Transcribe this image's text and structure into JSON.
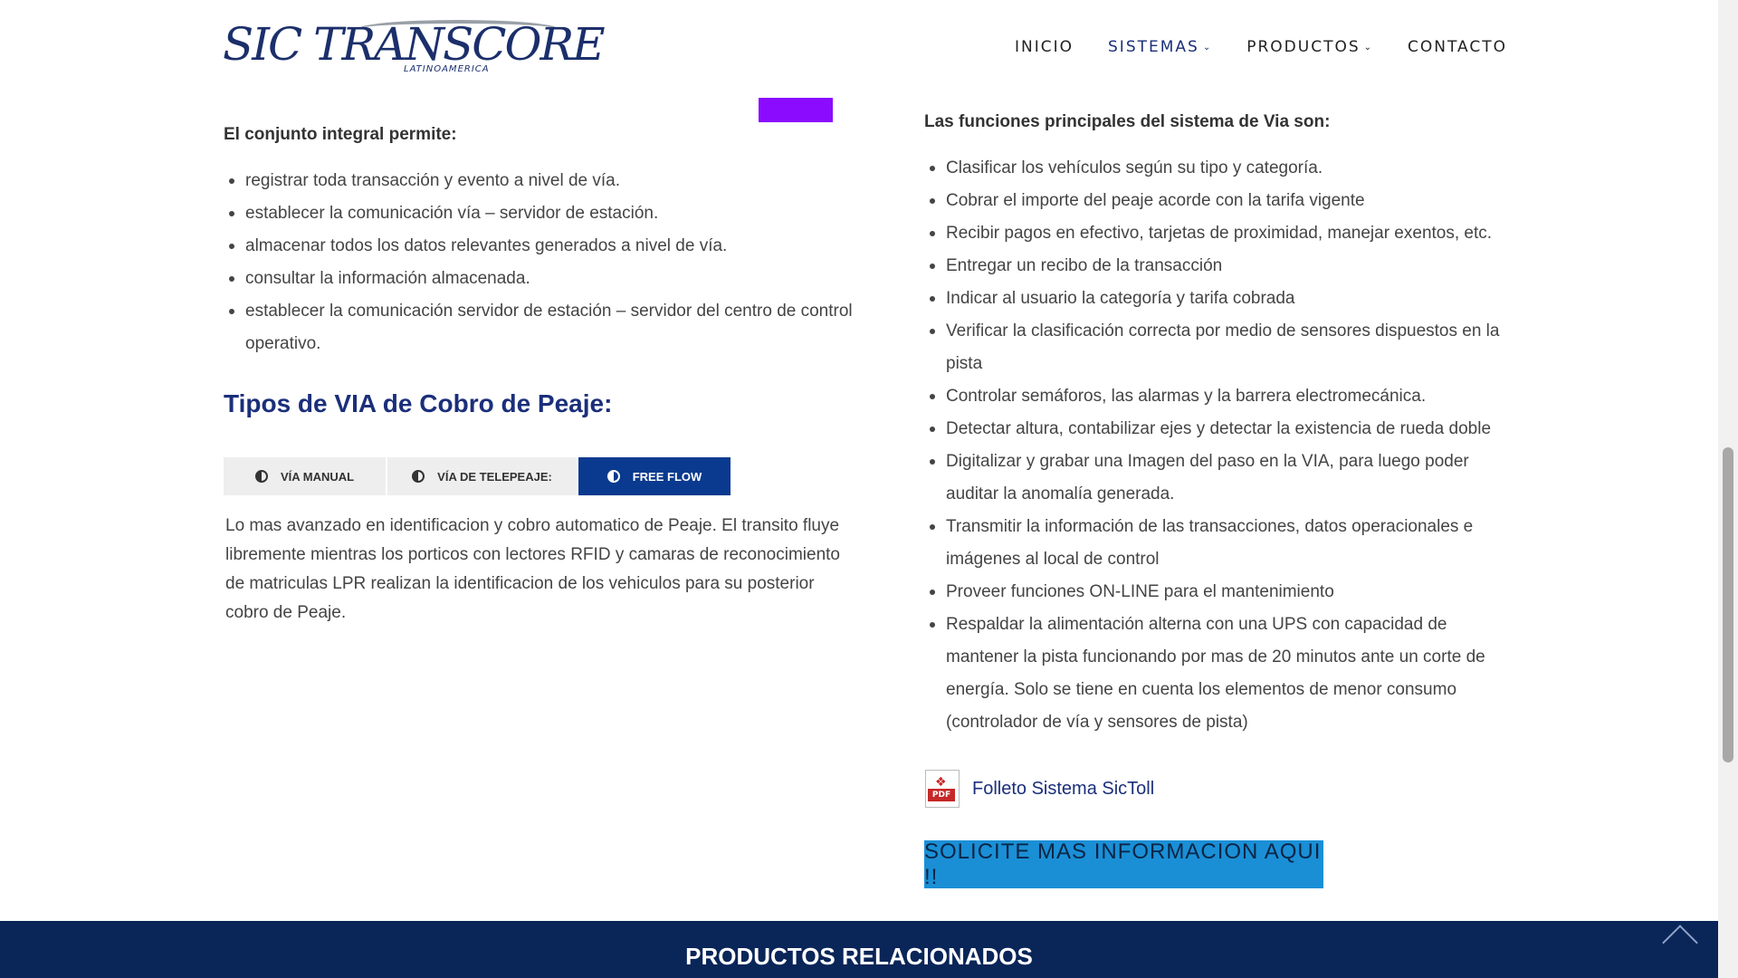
{
  "header": {
    "logo_text": "SIC TRANSCORE",
    "logo_sub": "LATINOAMERICA",
    "nav": [
      {
        "label": "INICIO",
        "has_dropdown": false,
        "active": false
      },
      {
        "label": "SISTEMAS",
        "has_dropdown": true,
        "active": true
      },
      {
        "label": "PRODUCTOS",
        "has_dropdown": true,
        "active": false
      },
      {
        "label": "CONTACTO",
        "has_dropdown": false,
        "active": false
      }
    ]
  },
  "left": {
    "intro": "El conjunto integral permite:",
    "items": [
      "registrar toda transacción y evento a nivel de vía.",
      "establecer la comunicación vía – servidor de estación.",
      "almacenar todos los datos relevantes generados a nivel de vía.",
      "consultar la información almacenada.",
      "establecer la comunicación servidor de estación – servidor del centro de control operativo."
    ],
    "heading": "Tipos de VIA de Cobro de Peaje:",
    "tabs": [
      {
        "label": "VÍA MANUAL",
        "active": false
      },
      {
        "label": "VÍA DE TELEPEAJE:",
        "active": false
      },
      {
        "label": "FREE FLOW",
        "active": true
      }
    ],
    "tab_content": "Lo mas avanzado en identificacion y cobro automatico de Peaje. El transito fluye libremente mientras los porticos con lectores RFID y camaras de reconocimiento de matriculas LPR realizan la identificacion de los vehiculos para su posterior cobro de Peaje."
  },
  "right": {
    "intro": "Las funciones principales del sistema de Via son:",
    "items": [
      "Clasificar los vehículos según su tipo y categoría.",
      "Cobrar el importe del peaje acorde con la tarifa vigente",
      "Recibir pagos en efectivo, tarjetas de proximidad, manejar exentos, etc.",
      "Entregar un recibo de la transacción",
      "Indicar al usuario la categoría y tarifa cobrada",
      "Verificar la clasificación correcta por medio de sensores dispuestos en la pista",
      "Controlar semáforos, las alarmas y la barrera electromecánica.",
      "Detectar altura, contabilizar ejes y detectar la existencia de rueda doble",
      "Digitalizar y grabar una Imagen del paso en la VIA, para luego poder auditar la anomalía generada.",
      "Transmitir la información de las transacciones, datos operacionales e imágenes al local de control",
      "Proveer funciones ON-LINE para el mantenimiento",
      "Respaldar la alimentación alterna con una UPS con capacidad de mantener la pista funcionando por mas de 20 minutos ante un corte de energía. Solo se tiene en cuenta los elementos de menor consumo (controlador de vía y sensores de pista)"
    ],
    "pdf_badge": "PDF",
    "pdf_link": "Folleto Sistema SicToll",
    "cta": "SOLICITE MAS INFORMACION AQUI !!"
  },
  "footer": {
    "title": "PRODUCTOS RELACIONADOS"
  },
  "colors": {
    "brand_navy": "#1b2f7a",
    "tab_active": "#0a3a8f",
    "cta_blue": "#1a8fd6",
    "footer_band": "#0a2558",
    "deco_purple": "#8b0bff"
  }
}
